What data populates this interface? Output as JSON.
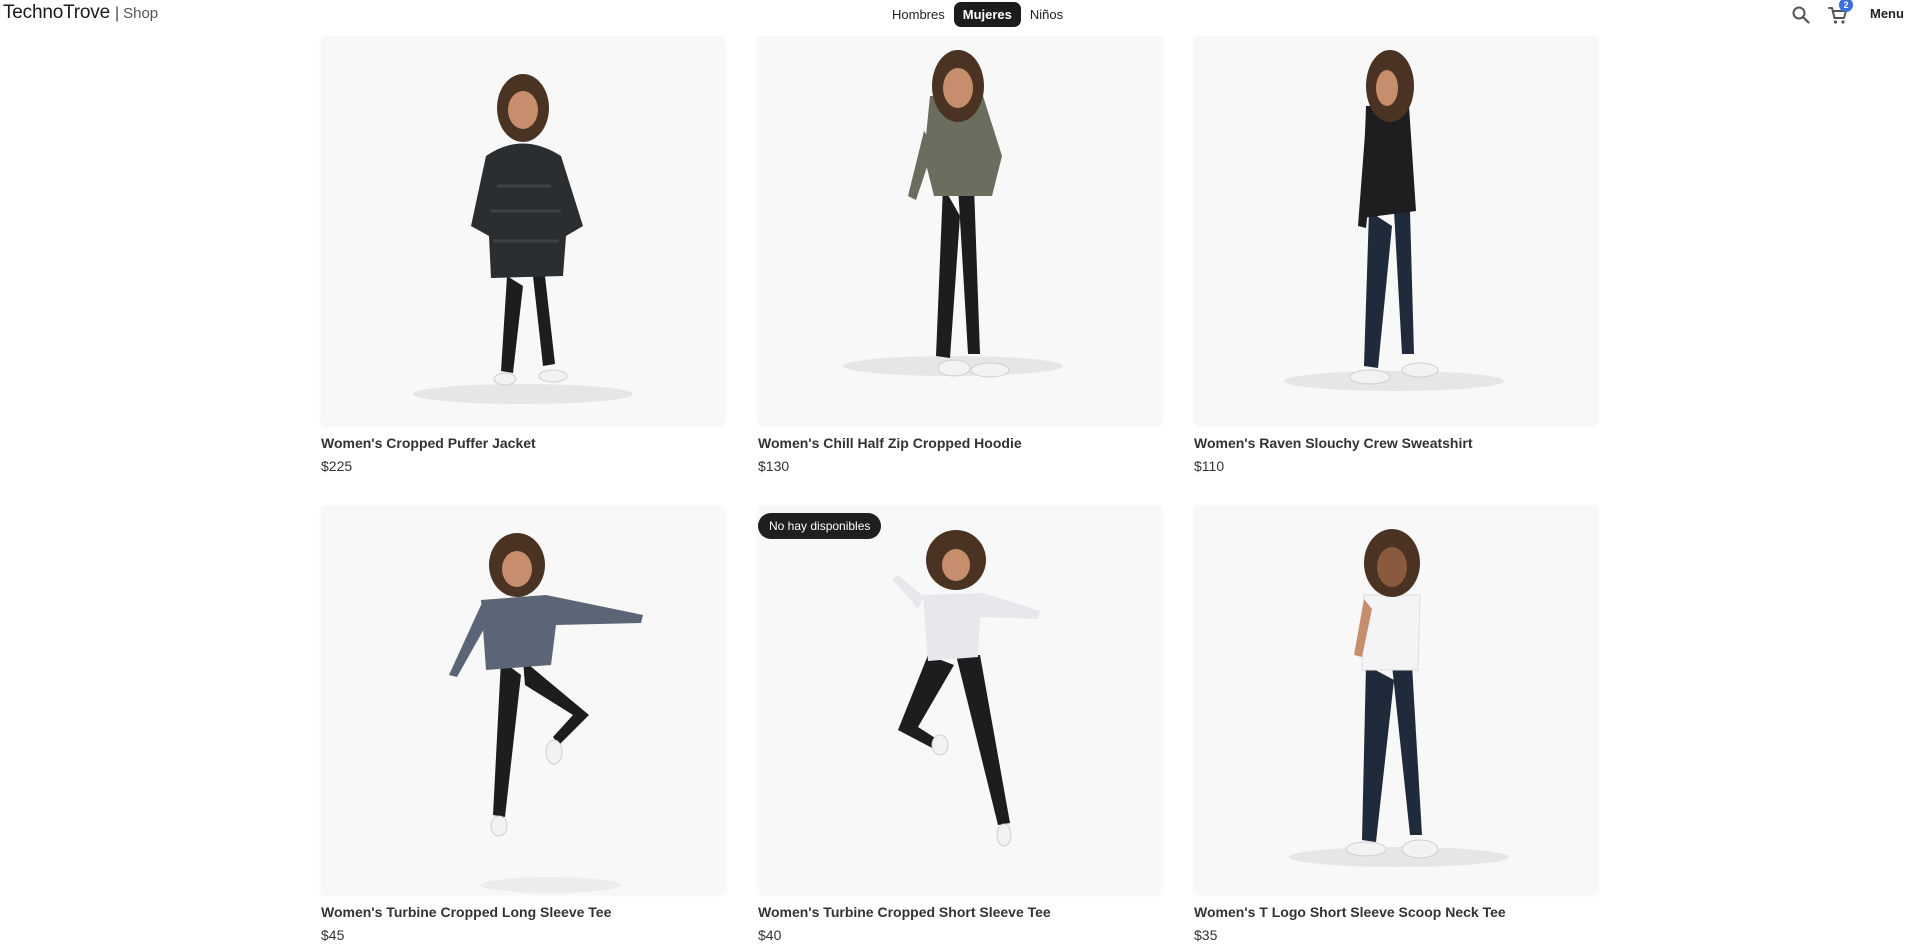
{
  "brand": {
    "name": "TechnoTrove",
    "separator": "|",
    "sub": "Shop"
  },
  "nav": [
    {
      "label": "Hombres",
      "active": false
    },
    {
      "label": "Mujeres",
      "active": true
    },
    {
      "label": "Niños",
      "active": false
    }
  ],
  "header": {
    "search_icon": "search-icon",
    "cart_icon": "cart-icon",
    "cart_count": "2",
    "menu_label": "Menu"
  },
  "colors": {
    "accent": "#3b6fe0",
    "dark": "#1c1c1e",
    "card_bg": "#f8f8f8"
  },
  "products": [
    {
      "name": "Women's Cropped Puffer Jacket",
      "price": "$225",
      "badge": ""
    },
    {
      "name": "Women's Chill Half Zip Cropped Hoodie",
      "price": "$130",
      "badge": ""
    },
    {
      "name": "Women's Raven Slouchy Crew Sweatshirt",
      "price": "$110",
      "badge": ""
    },
    {
      "name": "Women's Turbine Cropped Long Sleeve Tee",
      "price": "$45",
      "badge": ""
    },
    {
      "name": "Women's Turbine Cropped Short Sleeve Tee",
      "price": "$40",
      "badge": "No hay disponibles"
    },
    {
      "name": "Women's T Logo Short Sleeve Scoop Neck Tee",
      "price": "$35",
      "badge": ""
    }
  ]
}
